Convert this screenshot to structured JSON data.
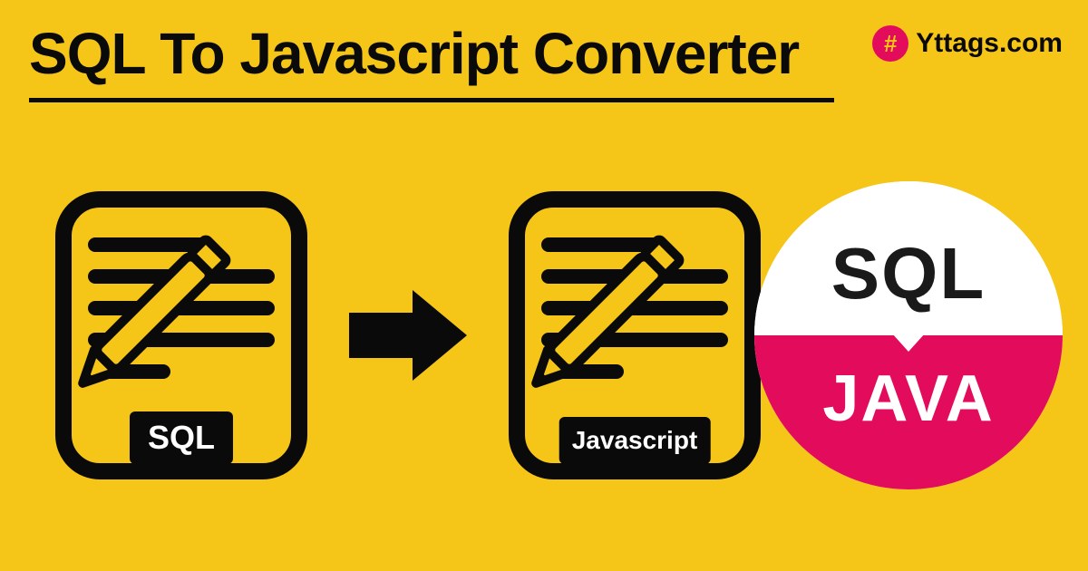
{
  "header": {
    "title": "SQL To Javascript Converter"
  },
  "brand": {
    "icon_glyph": "#",
    "text": "Yttags.com"
  },
  "graphic": {
    "left_label": "SQL",
    "right_label": "Javascript"
  },
  "badge": {
    "top_text": "SQL",
    "bottom_text": "JAVA"
  },
  "colors": {
    "background": "#F5C518",
    "ink": "#0a0a0a",
    "accent": "#E30B5C",
    "white": "#ffffff"
  }
}
